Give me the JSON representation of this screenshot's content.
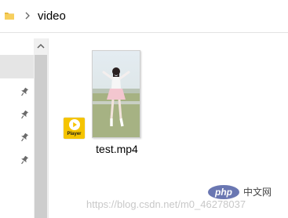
{
  "breadcrumb": {
    "current_folder": "video"
  },
  "navigation": {
    "pinned_items": 4,
    "selected_index": 0
  },
  "files": [
    {
      "name": "test.mp4",
      "type": "video",
      "badge_label": "Player"
    }
  ],
  "watermark": {
    "url": "https://blog.csdn.net/m0_46278037",
    "logo": "php",
    "site_name": "中文网"
  },
  "icons": {
    "folder": "folder-icon",
    "separator": "chevron-right-icon",
    "pin": "pin-icon",
    "scroll_up": "chevron-up-icon",
    "player": "play-icon"
  },
  "colors": {
    "badge": "#f5c400",
    "selection": "#e5e5e5",
    "php_logo": "#6a77b2"
  }
}
